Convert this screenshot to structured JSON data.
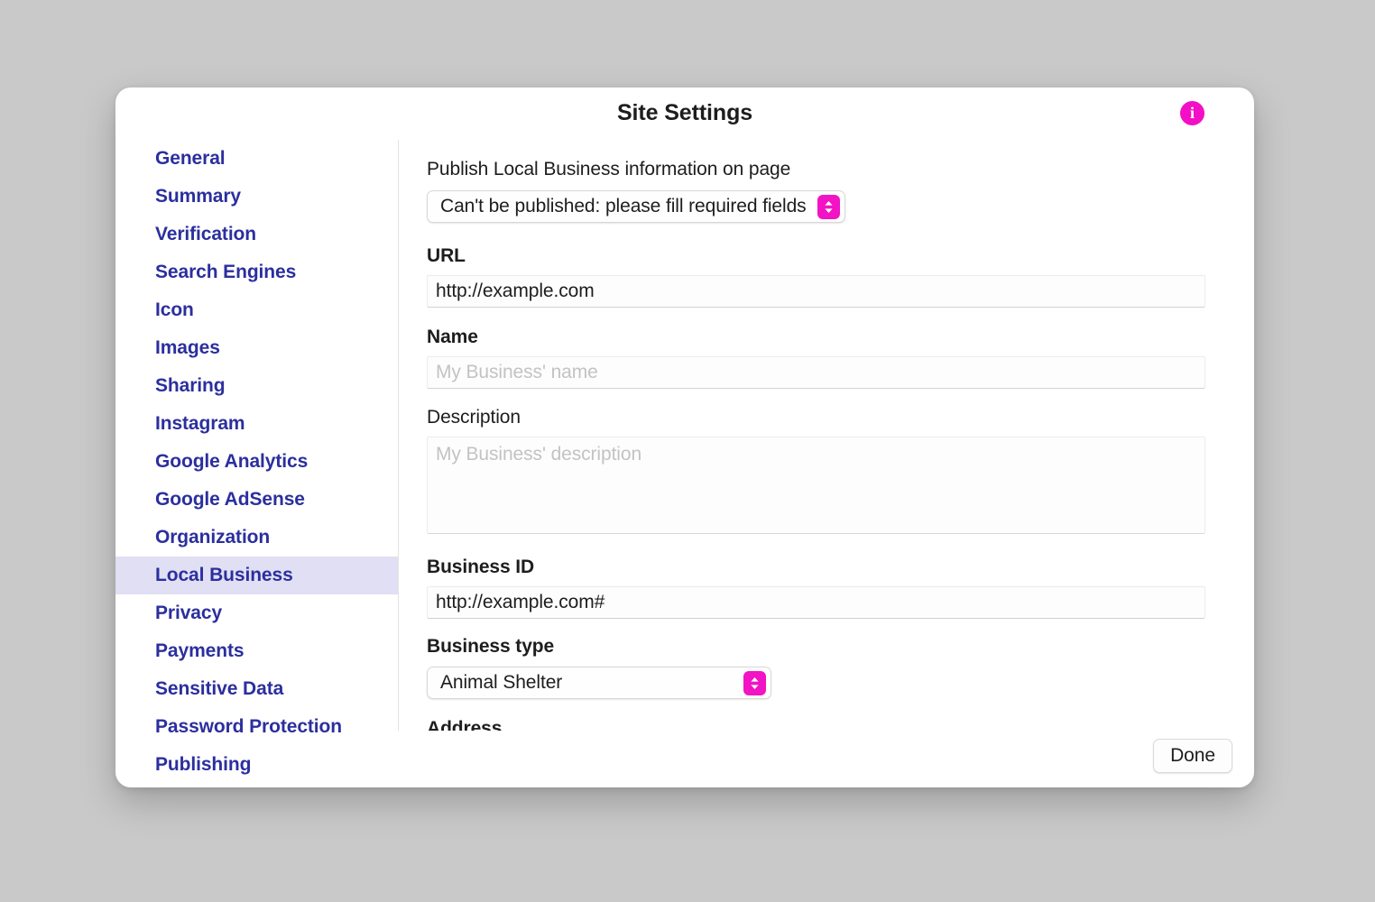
{
  "dialog": {
    "title": "Site Settings",
    "info_icon": "info-icon",
    "accent_color": "#f30fc5",
    "selected_row_color": "#e1dff3",
    "link_color": "#2b2f9e"
  },
  "sidebar": {
    "items": [
      {
        "label": "General",
        "selected": false
      },
      {
        "label": "Summary",
        "selected": false
      },
      {
        "label": "Verification",
        "selected": false
      },
      {
        "label": "Search Engines",
        "selected": false
      },
      {
        "label": "Icon",
        "selected": false
      },
      {
        "label": "Images",
        "selected": false
      },
      {
        "label": "Sharing",
        "selected": false
      },
      {
        "label": "Instagram",
        "selected": false
      },
      {
        "label": "Google Analytics",
        "selected": false
      },
      {
        "label": "Google AdSense",
        "selected": false
      },
      {
        "label": "Organization",
        "selected": false
      },
      {
        "label": "Local Business",
        "selected": true
      },
      {
        "label": "Privacy",
        "selected": false
      },
      {
        "label": "Payments",
        "selected": false
      },
      {
        "label": "Sensitive Data",
        "selected": false
      },
      {
        "label": "Password Protection",
        "selected": false
      },
      {
        "label": "Publishing",
        "selected": false
      }
    ]
  },
  "main": {
    "publish": {
      "label": "Publish Local Business information on page",
      "selected_option": "Can't be published: please fill required fields"
    },
    "url": {
      "label": "URL",
      "value": "http://example.com",
      "placeholder": ""
    },
    "name": {
      "label": "Name",
      "value": "",
      "placeholder": "My Business' name"
    },
    "description": {
      "label": "Description",
      "value": "",
      "placeholder": "My Business' description"
    },
    "business_id": {
      "label": "Business ID",
      "value": "http://example.com#",
      "placeholder": ""
    },
    "business_type": {
      "label": "Business type",
      "selected_option": "Animal Shelter"
    },
    "address": {
      "label": "Address"
    }
  },
  "footer": {
    "done_label": "Done"
  }
}
